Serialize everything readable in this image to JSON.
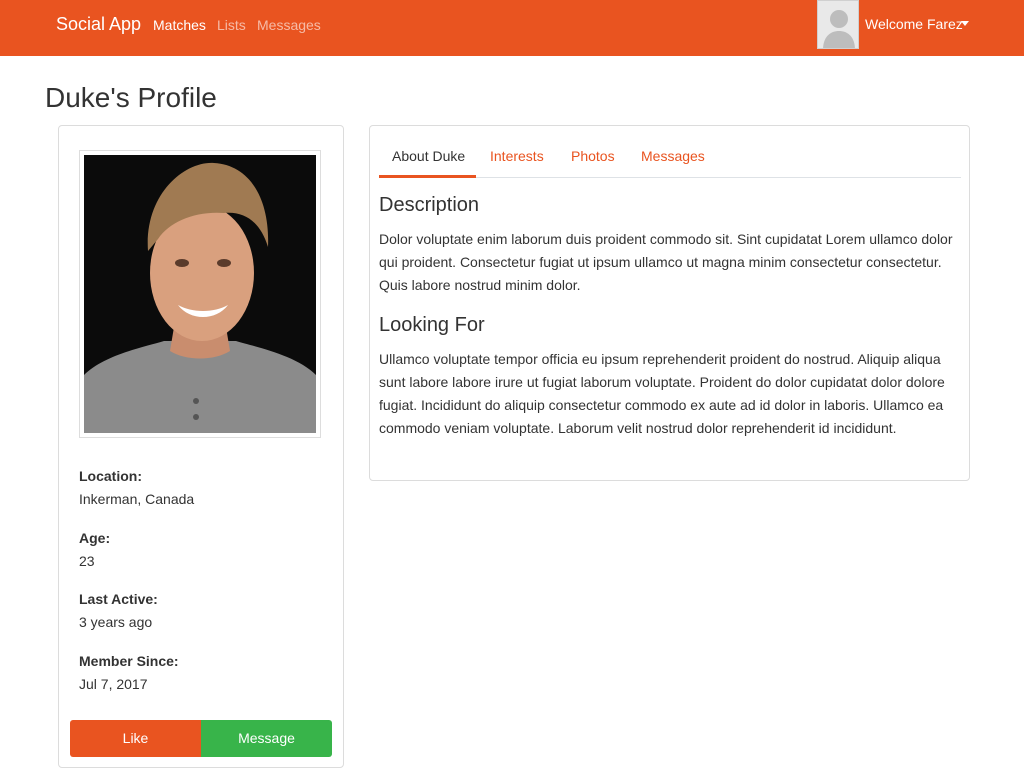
{
  "navbar": {
    "brand": "Social App",
    "links": [
      "Matches",
      "Lists",
      "Messages"
    ],
    "welcome": "Welcome Farez"
  },
  "page": {
    "title": "Duke's Profile"
  },
  "profile": {
    "location_label": "Location:",
    "location": "Inkerman, Canada",
    "age_label": "Age:",
    "age": "23",
    "last_active_label": "Last Active:",
    "last_active": "3 years ago",
    "member_since_label": "Member Since:",
    "member_since": "Jul 7, 2017",
    "like_label": "Like",
    "message_label": "Message"
  },
  "tabs": [
    "About Duke",
    "Interests",
    "Photos",
    "Messages"
  ],
  "about": {
    "description_heading": "Description",
    "description": "Dolor voluptate enim laborum duis proident commodo sit. Sint cupidatat Lorem ullamco dolor qui proident. Consectetur fugiat ut ipsum ullamco ut magna minim consectetur consectetur. Quis labore nostrud minim dolor.",
    "looking_heading": "Looking For",
    "looking_for": "Ullamco voluptate tempor officia eu ipsum reprehenderit proident do nostrud. Aliquip aliqua sunt labore labore irure ut fugiat laborum voluptate. Proident do dolor cupidatat dolor dolore fugiat. Incididunt do aliquip consectetur commodo ex aute ad id dolor in laboris. Ullamco ea commodo veniam voluptate. Laborum velit nostrud dolor reprehenderit id incididunt."
  },
  "colors": {
    "primary": "#e95420",
    "success": "#38b44a"
  }
}
